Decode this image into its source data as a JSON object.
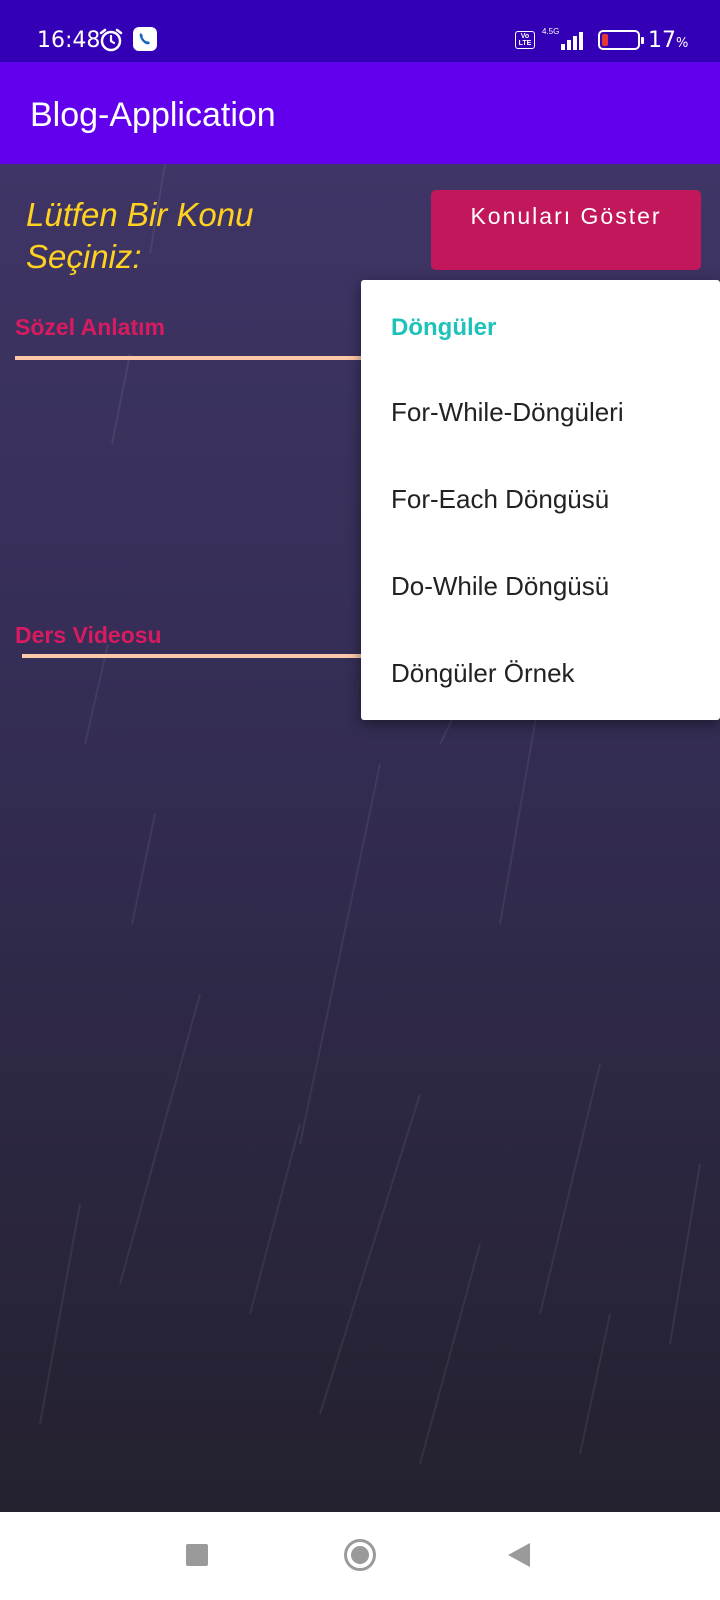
{
  "status_bar": {
    "time": "16:48",
    "volte": "Vo LTE",
    "network": "4.5G",
    "battery_percent": "17",
    "battery_unit": "%",
    "battery_level": 0.17,
    "icons": [
      "alarm-icon",
      "call-icon",
      "volte-icon",
      "signal-icon",
      "battery-icon"
    ]
  },
  "app_bar": {
    "title": "Blog-Application"
  },
  "main": {
    "prompt": "Lütfen Bir Konu Seçiniz:",
    "show_button": "Konuları Göster",
    "verbal_label": "Sözel Anlatım",
    "video_label": "Ders Videosu"
  },
  "popup": {
    "header": "Döngüler",
    "items": [
      {
        "label": "For-While-Döngüleri"
      },
      {
        "label": "For-Each Döngüsü"
      },
      {
        "label": "Do-While Döngüsü"
      },
      {
        "label": "Döngüler Örnek"
      }
    ]
  },
  "nav_bar": {
    "icons": [
      "recent-apps-icon",
      "home-icon",
      "back-icon"
    ]
  },
  "colors": {
    "status_bar": "#3300b5",
    "app_bar": "#6200ee",
    "prompt_text": "#ffd21f",
    "button": "#c2185b",
    "label": "#d81b60",
    "underline": "#ffc9a8",
    "popup_header": "#1fc2b8"
  }
}
